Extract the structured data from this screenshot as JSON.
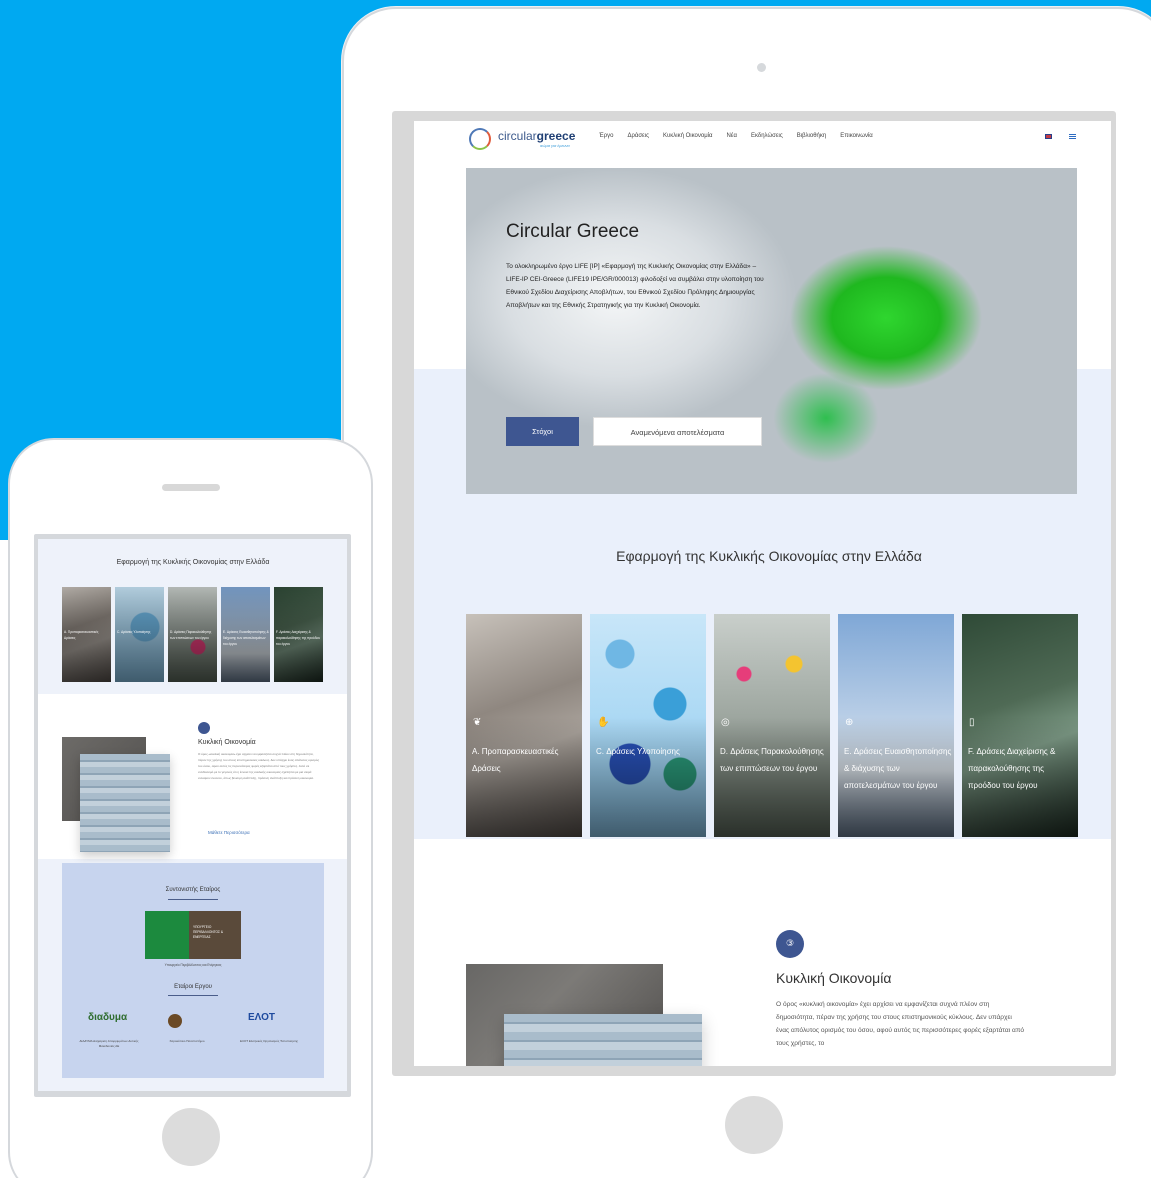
{
  "colors": {
    "backdrop": "#00a9f1",
    "primary": "#3e5691",
    "band": "#eaf0fb",
    "phone_panel": "#c7d4ee"
  },
  "site": {
    "logo_prefix": "circular",
    "logo_suffix": "greece",
    "logo_tagline": "σώμα για έρευνα",
    "nav": [
      "Έργο",
      "Δράσεις",
      "Κυκλική Οικονομία",
      "Νέα",
      "Εκδηλώσεις",
      "Βιβλιοθήκη",
      "Επικοινωνία"
    ]
  },
  "hero": {
    "title": "Circular Greece",
    "text": "Το ολοκληρωμένο έργο LIFE [IP] «Εφαρμογή της Κυκλικής Οικονομίας στην Ελλάδα» – LIFE-IP CEI-Greece (LIFE19 IPE/GR/000013) φιλοδοξεί να συμβάλει στην υλοποίηση του Εθνικού Σχεδίου Διαχείρισης Αποβλήτων, του Εθνικού Σχεδίου Πρόληψης Δημιουργίας Αποβλήτων και της Εθνικής Στρατηγικής για την Κυκλική Οικονομία.",
    "btn_goals": "Στόχοι",
    "btn_results": "Αναμενόμενα αποτελέσματα"
  },
  "section": {
    "title": "Εφαρμογή της Κυκλικής Οικονομίας στην Ελλάδα",
    "cards": [
      {
        "label": "Α. Προπαρασκευαστικές Δράσεις",
        "icon": "plant-icon"
      },
      {
        "label": "C. Δράσεις Υλοποίησης",
        "icon": "hand-icon"
      },
      {
        "label": "D. Δράσεις Παρακολούθησης των επιπτώσεων του έργου",
        "icon": "target-icon"
      },
      {
        "label": "E. Δράσεις Ευαισθητοποίησης & διάχυσης των αποτελεσμάτων του έργου",
        "icon": "globe-icon"
      },
      {
        "label": "F. Δράσεις Διαχείρισης & παρακολούθησης της προόδου του έργου",
        "icon": "clipboard-icon"
      }
    ]
  },
  "circular": {
    "badge": "③",
    "title": "Κυκλική Οικονομία",
    "text": "Ο όρος «κυκλική οικονομία» έχει αρχίσει να εμφανίζεται συχνά πλέον στη δημοσιότητα, πέραν της χρήσης του στους επιστημονικούς κύκλους. Δεν υπάρχει ένας απόλυτος ορισμός του όσου, αφού αυτός τις περισσότερες φορές εξαρτάται από τους χρήστες, το"
  },
  "phone": {
    "section_title": "Εφαρμογή της Κυκλικής Οικονομίας στην Ελλάδα",
    "cards": [
      "Α. Προπαρασκευαστικές Δράσεις",
      "C. Δράσεις Υλοποίησης",
      "D. Δράσεις Παρακολούθησης των επιπτώσεων του έργου",
      "E. Δράσεις Ευαισθητοποίησης & διάχυσης των αποτελεσμάτων του έργου",
      "F. Δράσεις Διαχείρισης & παρακολούθησης της προόδου του έργου"
    ],
    "ce_title": "Κυκλική Οικονομία",
    "ce_text": "Ο όρος «κυκλική οικονομία» έχει αρχίσει να εμφανίζεται συχνά πλέον στη δημοσιότητα, πέραν της χρήσης του στους επιστημονικούς κύκλους. Δεν υπάρχει ένας απόλυτος ορισμός του όσου, αφού αυτός τις περισσότερες φορές εξαρτάται από τους χρήστες. Αυτό σε συνδυασμό με το γεγονός ότι η έννοια της κυκλικής οικονομίας σχετίζεται με μια σειρά συναφών εννοιών, όπως βιώσιμη ανάπτυξη, πράσινη ανάπτυξη και πράσινη οικονομία.",
    "more_link": "Μάθετε Περισσότερα",
    "coordinator_title": "Συντονιστής Εταίρος",
    "ministry_text": "ΥΠΟΥΡΓΕΙΟ ΠΕΡΙΒΑΛΛΟΝΤΟΣ & ΕΝΕΡΓΕΙΑΣ",
    "ministry_caption": "Υπουργείο Περιβάλλοντος και Ενέργειας",
    "partners_title": "Εταίροι Εργου",
    "partner_logos": [
      "διαδυμα",
      "ΕΛΟΤ"
    ],
    "partner_captions": [
      "ΔΙΑΔΥΜΑ Διαχείριση Απορριμμάτων Δυτικής Μακεδονίας ΑΕ",
      "Χαροκόπειο Πανεπιστήμιο",
      "ΕΛΟΤ Ελληνικός Οργανισμός Τυποποίησης"
    ]
  }
}
